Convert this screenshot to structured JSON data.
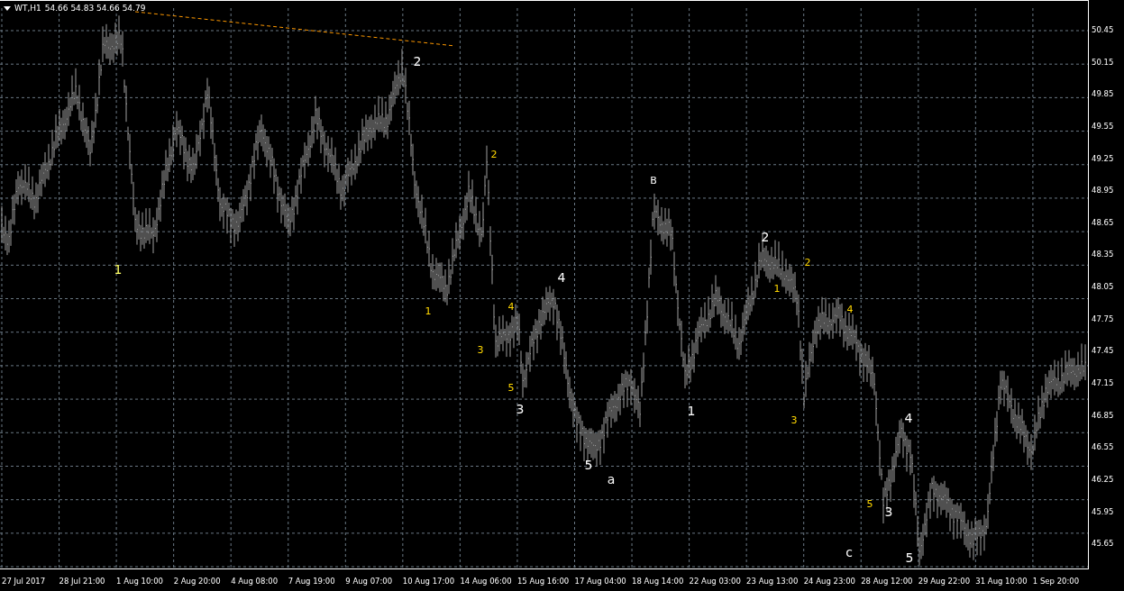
{
  "header": {
    "symbol": "WT,H1",
    "quotes": "54.66 54.83 54.66 54.79"
  },
  "price_axis": [
    "50.45",
    "50.15",
    "49.85",
    "49.55",
    "49.25",
    "48.95",
    "48.65",
    "48.35",
    "48.05",
    "47.75",
    "47.45",
    "47.15",
    "46.85",
    "46.55",
    "46.25",
    "45.95",
    "45.65"
  ],
  "time_axis": [
    "27 Jul 2017",
    "28 Jul 21:00",
    "1 Aug 10:00",
    "2 Aug 20:00",
    "4 Aug 08:00",
    "7 Aug 19:00",
    "9 Aug 07:00",
    "10 Aug 17:00",
    "14 Aug 06:00",
    "15 Aug 16:00",
    "17 Aug 04:00",
    "18 Aug 14:00",
    "22 Aug 03:00",
    "23 Aug 13:00",
    "24 Aug 23:00",
    "28 Aug 12:00",
    "29 Aug 22:00",
    "31 Aug 10:00",
    "1 Sep 20:00"
  ],
  "wave_labels": [
    {
      "text": "2",
      "kind": "primary",
      "color": "#ffffff"
    },
    {
      "text": "1",
      "kind": "primary",
      "color": "#ffff66"
    },
    {
      "text": "2",
      "kind": "minor",
      "color": "#ffd700"
    },
    {
      "text": "1",
      "kind": "minor",
      "color": "#ffd700"
    },
    {
      "text": "4",
      "kind": "minor",
      "color": "#ffd700"
    },
    {
      "text": "3",
      "kind": "minor",
      "color": "#ffd700"
    },
    {
      "text": "5",
      "kind": "minor",
      "color": "#ffd700"
    },
    {
      "text": "3",
      "kind": "primary",
      "color": "#ffffff"
    },
    {
      "text": "4",
      "kind": "primary",
      "color": "#ffffff"
    },
    {
      "text": "5",
      "kind": "primary",
      "color": "#ffffff"
    },
    {
      "text": "a",
      "kind": "primary",
      "color": "#ffffff"
    },
    {
      "text": "B",
      "kind": "minor",
      "color": "#ffffff"
    },
    {
      "text": "1",
      "kind": "primary",
      "color": "#ffffff"
    },
    {
      "text": "2",
      "kind": "primary",
      "color": "#ffffff"
    },
    {
      "text": "2",
      "kind": "minor",
      "color": "#ffd700"
    },
    {
      "text": "1",
      "kind": "minor",
      "color": "#ffd700"
    },
    {
      "text": "4",
      "kind": "minor",
      "color": "#ffd700"
    },
    {
      "text": "3",
      "kind": "minor",
      "color": "#ffd700"
    },
    {
      "text": "4",
      "kind": "primary",
      "color": "#ffffff"
    },
    {
      "text": "5",
      "kind": "minor",
      "color": "#ffd700"
    },
    {
      "text": "3",
      "kind": "primary",
      "color": "#ffffff"
    },
    {
      "text": "c",
      "kind": "primary",
      "color": "#ffffff"
    },
    {
      "text": "5",
      "kind": "primary",
      "color": "#ffffff"
    }
  ]
}
